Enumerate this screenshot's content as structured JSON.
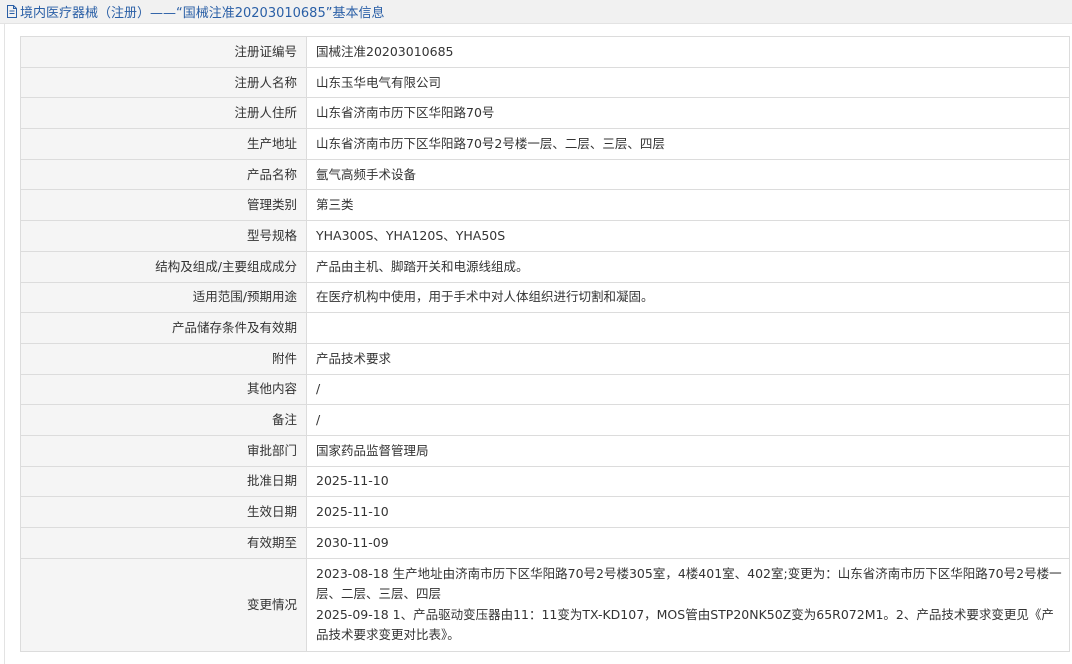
{
  "header": {
    "title": "境内医疗器械（注册）——“国械注准20203010685”基本信息"
  },
  "rows": [
    {
      "label": "注册证编号",
      "value": "国械注准20203010685"
    },
    {
      "label": "注册人名称",
      "value": "山东玉华电气有限公司"
    },
    {
      "label": "注册人住所",
      "value": "山东省济南市历下区华阳路70号"
    },
    {
      "label": "生产地址",
      "value": "山东省济南市历下区华阳路70号2号楼一层、二层、三层、四层"
    },
    {
      "label": "产品名称",
      "value": "氩气高频手术设备"
    },
    {
      "label": "管理类别",
      "value": "第三类"
    },
    {
      "label": "型号规格",
      "value": "YHA300S、YHA120S、YHA50S"
    },
    {
      "label": "结构及组成/主要组成成分",
      "value": "产品由主机、脚踏开关和电源线组成。"
    },
    {
      "label": "适用范围/预期用途",
      "value": "在医疗机构中使用，用于手术中对人体组织进行切割和凝固。"
    },
    {
      "label": "产品储存条件及有效期",
      "value": ""
    },
    {
      "label": "附件",
      "value": "产品技术要求"
    },
    {
      "label": "其他内容",
      "value": "/"
    },
    {
      "label": "备注",
      "value": "/"
    },
    {
      "label": "审批部门",
      "value": "国家药品监督管理局"
    },
    {
      "label": "批准日期",
      "value": "2025-11-10"
    },
    {
      "label": "生效日期",
      "value": "2025-11-10"
    },
    {
      "label": "有效期至",
      "value": "2030-11-09"
    }
  ],
  "changes": {
    "label": "变更情况",
    "entries": [
      "2023-08-18 生产地址由济南市历下区华阳路70号2号楼305室，4楼401室、402室;变更为：山东省济南市历下区华阳路70号2号楼一层、二层、三层、四层",
      "2025-09-18 1、产品驱动变压器由11：11变为TX-KD107，MOS管由STP20NK50Z变为65R072M1。2、产品技术要求变更见《产品技术要求变更对比表》。"
    ]
  },
  "colors": {
    "header_text": "#2a5fa6",
    "label_bg": "#f5f5f5",
    "border": "#dcdcdc"
  }
}
